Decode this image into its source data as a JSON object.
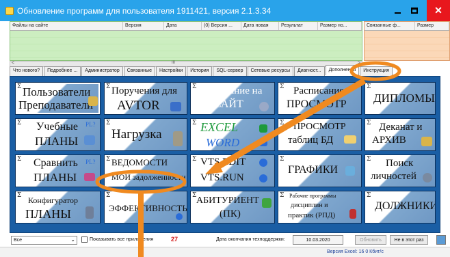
{
  "window": {
    "title": "Обновление программ для пользователя 1911421, версия 2.1.3.34"
  },
  "grid": {
    "columns": [
      "Файлы на сайте",
      "Версия",
      "Дата",
      "(0) Версия ...",
      "Дата новая",
      "Результат",
      "Размер но..."
    ]
  },
  "grid_side": {
    "columns": [
      "Связанные ф...",
      "Размер"
    ]
  },
  "scrollbar": {
    "mid": "III",
    "left": "<",
    "right": ">"
  },
  "tabs": [
    "Что нового?",
    "Подробнее ...",
    "Администратор",
    "Связанные",
    "Настройки",
    "История",
    "SQL-сервер",
    "Сетевые ресурсы",
    "Диагност...",
    "Дополнения",
    "Инструкция"
  ],
  "tiles": [
    {
      "name": "tile-teachers",
      "line1": "Пользователи",
      "line2": "Преподаватели"
    },
    {
      "name": "tile-avtor",
      "line1": "Поручения для",
      "line2": "AVTOR"
    },
    {
      "name": "tile-schedule",
      "line1": "Расписание на",
      "line2": "САЙТ"
    },
    {
      "name": "tile-schedule-view",
      "line1": "Расписание",
      "line2": "ПРОСМОТР"
    },
    {
      "name": "tile-diplomas",
      "line1": "ДИПЛОМЫ",
      "line2": ""
    },
    {
      "name": "tile-plans",
      "line1": "Учебные",
      "line2": "ПЛАНЫ",
      "badge": "PL?"
    },
    {
      "name": "tile-load",
      "line1": "Нагрузка",
      "line2": ""
    },
    {
      "name": "tile-excel-word",
      "line1": "EXCEL",
      "line2": "WORD"
    },
    {
      "name": "tile-db-view",
      "line1": "ПРОСМОТР",
      "line2": "таблиц БД"
    },
    {
      "name": "tile-dean-archive",
      "line1": "Деканат и",
      "line2": "АРХИВ"
    },
    {
      "name": "tile-compare-plans",
      "line1": "Сравнить",
      "line2": "ПЛАНЫ",
      "badge": "PL?"
    },
    {
      "name": "tile-statements",
      "line1": "ВЕДОМОСТИ",
      "line2": "МОИ задолженности"
    },
    {
      "name": "tile-vts",
      "line1": "VTS.EDIT",
      "line2": "VTS.RUN"
    },
    {
      "name": "tile-graphs",
      "line1": "ГРАФИКИ",
      "line2": ""
    },
    {
      "name": "tile-search",
      "line1": "Поиск",
      "line2": "личностей"
    },
    {
      "name": "tile-configurator",
      "line1": "Конфигуратор",
      "line2": "ПЛАНЫ"
    },
    {
      "name": "tile-efficiency",
      "line1": "ЭФФЕКТИВНОСТЬ",
      "line2": ""
    },
    {
      "name": "tile-applicant",
      "line1": "АБИТУРИЕНТ",
      "line2": "(ПК)"
    },
    {
      "name": "tile-rpd",
      "line1": "Рабочие программы",
      "line2": "дисциплин и",
      "line3": "практик (РПД)"
    },
    {
      "name": "tile-debtors",
      "line1": "ДОЛЖНИКИ",
      "line2": ""
    }
  ],
  "bottom": {
    "filter_value": "Все",
    "show_all_label": "Показывать все приложения",
    "count": "27",
    "support_label": "Дата окончания техподдержки:",
    "support_date": "10.03.2020",
    "update_label": "Обновить",
    "not_this_label": "Не в этот раз"
  },
  "status": {
    "text": "Версия Excel: 16 0 Кбит/с"
  },
  "colors": {
    "titlebar": "#29a3ea",
    "panel": "#1a5ea4",
    "highlight": "#f08a20",
    "close": "#e8171d"
  }
}
